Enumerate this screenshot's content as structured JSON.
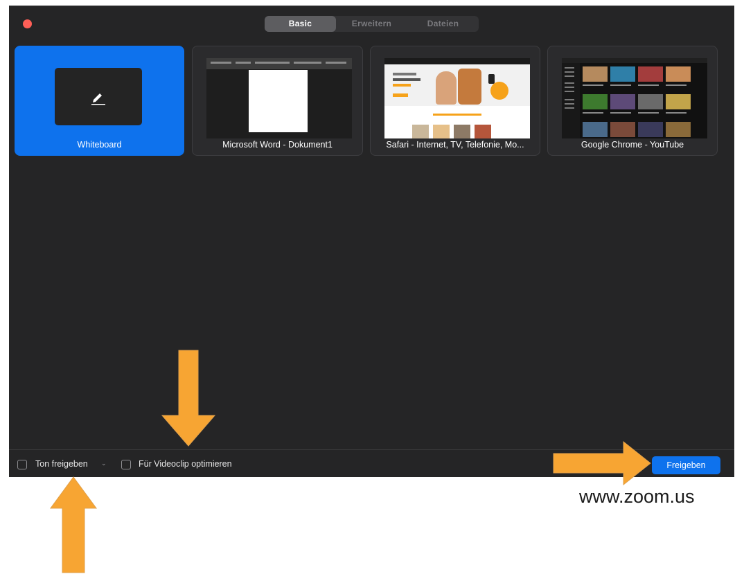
{
  "tabs": [
    {
      "label": "Basic",
      "active": true
    },
    {
      "label": "Erweitern",
      "active": false
    },
    {
      "label": "Dateien",
      "active": false
    }
  ],
  "share_items": [
    {
      "label": "Whiteboard",
      "selected": true,
      "icon": "pencil-icon"
    },
    {
      "label": "Microsoft Word - Dokument1",
      "selected": false
    },
    {
      "label": "Safari - Internet, TV, Telefonie, Mo...",
      "selected": false
    },
    {
      "label": "Google Chrome - YouTube",
      "selected": false
    }
  ],
  "options": {
    "share_audio_label": "Ton freigeben",
    "share_audio_caret": "⌄",
    "optimize_video_label": "Für Videoclip optimieren"
  },
  "share_button_label": "Freigeben",
  "footer_url": "www.zoom.us",
  "colors": {
    "accent": "#0e72ed",
    "window_bg": "#252526",
    "annotation_arrow": "#f7a533",
    "close_dot": "#fe5f57"
  }
}
